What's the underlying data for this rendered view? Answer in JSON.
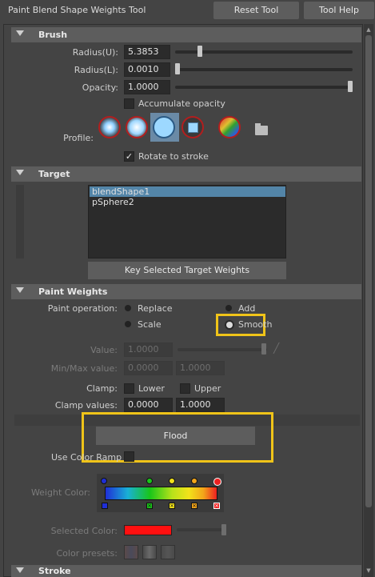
{
  "window": {
    "title": "Paint Blend Shape Weights Tool",
    "reset_label": "Reset Tool",
    "help_label": "Tool Help"
  },
  "brush": {
    "header": "Brush",
    "radius_u_label": "Radius(U):",
    "radius_u_value": "5.3853",
    "radius_l_label": "Radius(L):",
    "radius_l_value": "0.0010",
    "opacity_label": "Opacity:",
    "opacity_value": "1.0000",
    "accumulate_label": "Accumulate opacity",
    "profile_label": "Profile:",
    "rotate_label": "Rotate to stroke",
    "rotate_checked": true,
    "radius_u_level": 0.13,
    "radius_l_level": 0.0,
    "opacity_level": 1.0
  },
  "target": {
    "header": "Target",
    "items": [
      "blendShape1",
      "pSphere2"
    ],
    "key_button_label": "Key Selected Target Weights"
  },
  "paint_weights": {
    "header": "Paint Weights",
    "operation_label": "Paint operation:",
    "op_replace": "Replace",
    "op_add": "Add",
    "op_scale": "Scale",
    "op_smooth": "Smooth",
    "selected_op": "Smooth",
    "value_label": "Value:",
    "value": "1.0000",
    "minmax_label": "Min/Max value:",
    "min_value": "0.0000",
    "max_value": "1.0000",
    "clamp_label": "Clamp:",
    "clamp_lower": "Lower",
    "clamp_upper": "Upper",
    "clamp_values_label": "Clamp values:",
    "clamp_min": "0.0000",
    "clamp_max": "1.0000",
    "flood_label": "Flood",
    "use_color_ramp_label": "Use Color Ramp",
    "weight_color_label": "Weight Color:",
    "selected_color_label": "Selected Color:",
    "selected_color": "#ff1010",
    "color_presets_label": "Color presets:"
  },
  "stroke": {
    "header": "Stroke"
  },
  "colors": {
    "highlight": "#f0c419",
    "selection": "#5385a8",
    "ramp_markers": [
      "#1f2fd6",
      "#19c519",
      "#f2e21a",
      "#f2a51a",
      "#ee2020"
    ]
  }
}
